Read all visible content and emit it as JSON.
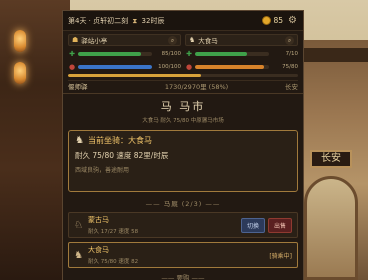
{
  "status": {
    "day_info": "第4天 · 贞轩初二刻",
    "turn": "32时辰",
    "gold": "85"
  },
  "party": {
    "left_name": "驿站小亭",
    "right_name": "大食马"
  },
  "bars": [
    {
      "icon": "hp-icon",
      "glyph": "♥",
      "color": "#3fa14a",
      "value": "85/100",
      "fraction": 0.85
    },
    {
      "icon": "stamina-icon",
      "glyph": "⬤",
      "color": "#3fa14a",
      "value": "7/10",
      "fraction": 0.7
    },
    {
      "icon": "energy-icon",
      "glyph": "⬤",
      "color": "#3a74c8",
      "value": "100/100",
      "fraction": 1.0
    },
    {
      "icon": "horse-hp-icon",
      "glyph": "⬤",
      "color": "#d8832a",
      "value": "75/80",
      "fraction": 0.9375
    }
  ],
  "travel": {
    "location": "偃师驿",
    "progress": "1730/2970里 (58%)",
    "destination": "长安",
    "progress_fraction": 0.58
  },
  "market": {
    "title": "马 马市",
    "subtitle": "大食马 耐久 75/80    中原骡马市场"
  },
  "current": {
    "heading": "当前坐骑：大食马",
    "stats": "耐久 75/80  速度 82里/时辰",
    "origin": "西域良驹，善途耐用"
  },
  "stable": {
    "title": "—— 马厩 (2/3) ——",
    "items": [
      {
        "name": "蒙古马",
        "stats": "耐久 17/27  速度 58",
        "switch": "切换",
        "sell": "出售"
      },
      {
        "name": "大食马",
        "stats": "耐久 75/80  速度 82",
        "tag": "[骑乘中]"
      }
    ],
    "bottom": "—— 要购 ——"
  },
  "scene": {
    "gate_sign": "长安"
  }
}
